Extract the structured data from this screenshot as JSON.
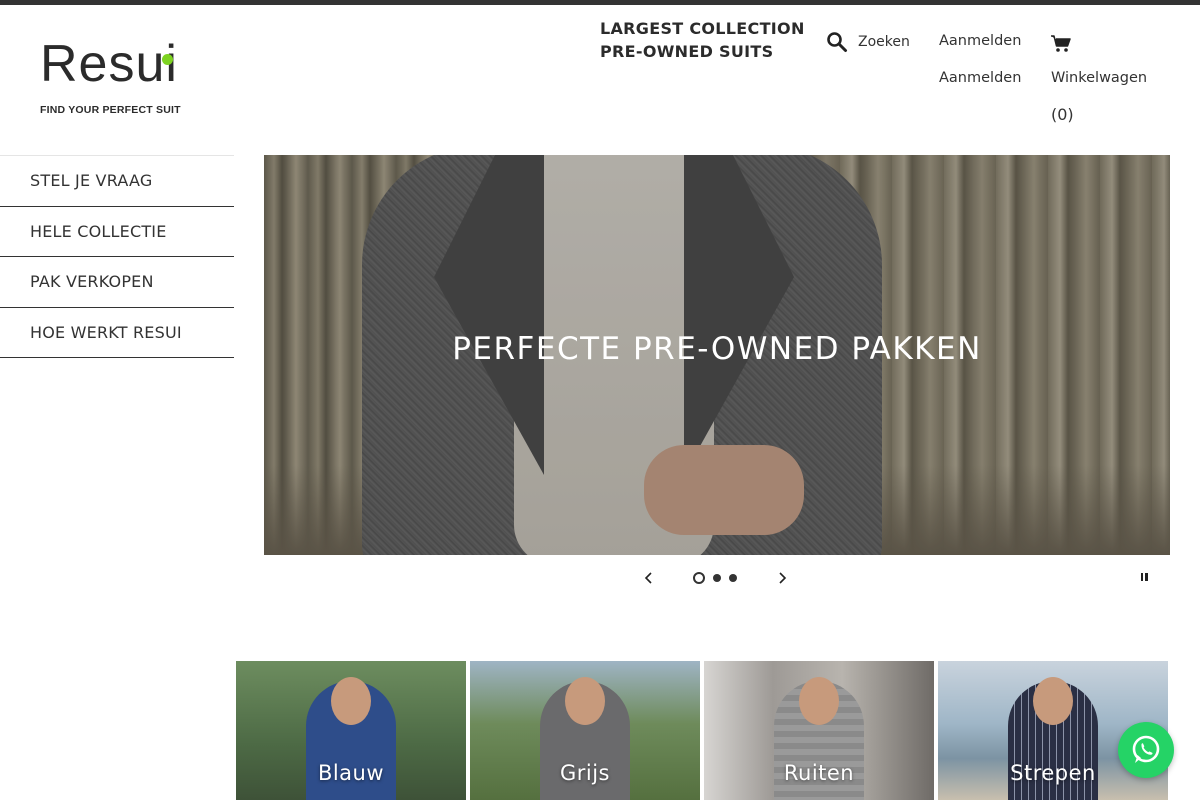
{
  "brand": {
    "logo_text": "Resui",
    "tagline": "FIND YOUR PERFECT SUIT",
    "accent_color": "#7ed321"
  },
  "header": {
    "promo_line1": "LARGEST COLLECTION",
    "promo_line2": "PRE-OWNED SUITS",
    "search_label": "Zoeken",
    "login_label": "Aanmelden",
    "login_label_2": "Aanmelden",
    "cart_label": "Winkelwagen",
    "cart_count": "(0)",
    "icons": [
      "search-icon",
      "cart-icon"
    ]
  },
  "sidebar": {
    "items": [
      {
        "label": "STEL JE VRAAG"
      },
      {
        "label": "HELE COLLECTIE"
      },
      {
        "label": "PAK VERKOPEN"
      },
      {
        "label": "HOE WERKT RESUI"
      }
    ]
  },
  "hero": {
    "title": "PERFECTE PRE-OWNED PAKKEN",
    "slide_count": 3,
    "active_slide": 1
  },
  "collections": [
    {
      "label": "Blauw"
    },
    {
      "label": "Grijs"
    },
    {
      "label": "Ruiten"
    },
    {
      "label": "Strepen"
    }
  ],
  "whatsapp": {
    "icon": "whatsapp-icon",
    "color": "#25d366"
  }
}
